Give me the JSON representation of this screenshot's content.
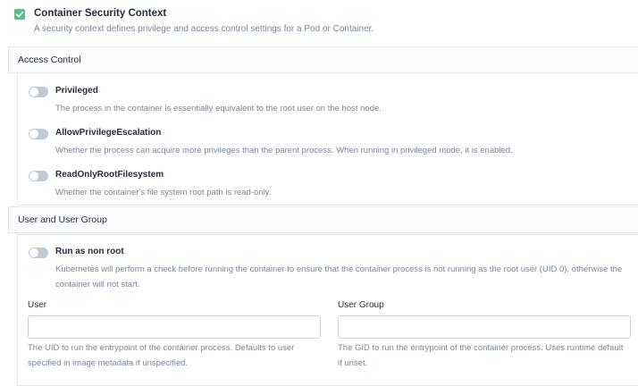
{
  "context": {
    "checked": true,
    "title": "Container Security Context",
    "description": "A security context defines privilege and access control settings for a Pod or Container."
  },
  "access_control": {
    "title": "Access Control",
    "items": [
      {
        "label": "Privileged",
        "description": "The process in the container is essentially equivalent to the root user on the host node.",
        "enabled": false
      },
      {
        "label": "AllowPrivilegeEscalation",
        "description": "Whether the process can acquire more privileges than the parent process. When running in privileged mode, it is enabled.",
        "enabled": false
      },
      {
        "label": "ReadOnlyRootFilesystem",
        "description": "Whether the container's file system root path is read-only.",
        "enabled": false
      }
    ]
  },
  "user_group": {
    "title": "User and User Group",
    "run_as_non_root": {
      "label": "Run as non root",
      "description": "Kubernetes will perform a check before running the container to ensure that the container process is not running as the root user (UID 0), otherwise the container will not start.",
      "enabled": false
    },
    "user": {
      "label": "User",
      "value": "",
      "description": "The UID to run the entrypoint of the container process. Defaults to user specified in image metadata if unspecified."
    },
    "group": {
      "label": "User Group",
      "value": "",
      "description": "The GID to run the entrypoint of the container process. Uses runtime default if unset."
    }
  },
  "colors": {
    "accent": "#55bc8a",
    "toggle_off": "#c1c9d1",
    "text": "#242e42",
    "muted": "#79879c",
    "border": "#e3e9ef"
  }
}
